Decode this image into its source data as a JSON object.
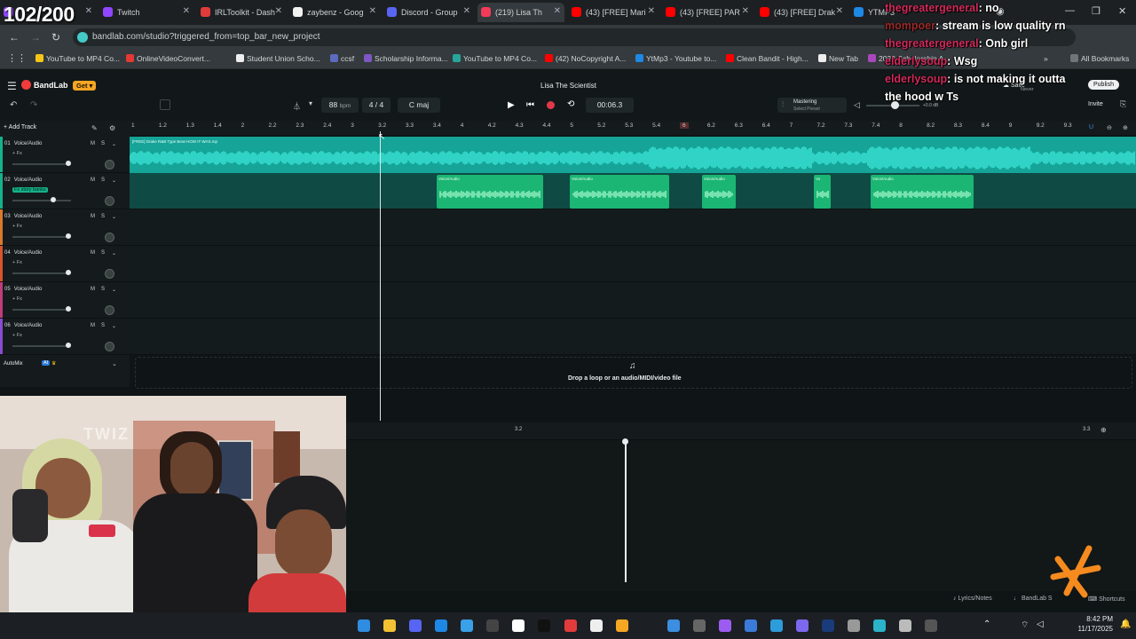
{
  "overlay": {
    "counter": "102/200",
    "chat": [
      {
        "user": "thegreatergeneral",
        "sep": ":",
        "msg": " no"
      },
      {
        "user": "mompoer",
        "sep": ":",
        "msg": " stream is low quality rn"
      },
      {
        "user": "thegreatergeneral",
        "sep": ":",
        "msg": " Onb girl"
      },
      {
        "user": "elderlysoup",
        "sep": ":",
        "msg": " Wsg"
      },
      {
        "user": "elderlysoup",
        "sep": ":",
        "msg": " is not making it outta"
      },
      {
        "user": "",
        "sep": "",
        "msg": "the hood w Ts"
      }
    ],
    "webcam_text": "TWIZ"
  },
  "browser": {
    "tabs": [
      {
        "label": "",
        "icon_color": "#9146ff"
      },
      {
        "label": "Twitch",
        "icon_color": "#9146ff"
      },
      {
        "label": "IRLToolkit - Dash",
        "icon_color": "#e23b3b"
      },
      {
        "label": "zaybenz - Goog",
        "icon_color": "#f2f2f2"
      },
      {
        "label": "Discord - Group",
        "icon_color": "#5865f2"
      },
      {
        "label": "(219) Lisa Th",
        "icon_color": "#f23b5a",
        "active": true
      },
      {
        "label": "(43) [FREE] Mari",
        "icon_color": "#ff0000"
      },
      {
        "label": "(43) [FREE] PAR",
        "icon_color": "#ff0000"
      },
      {
        "label": "(43) [FREE] Drak",
        "icon_color": "#ff0000"
      },
      {
        "label": "YTMP3",
        "icon_color": "#1e88e5"
      }
    ],
    "url": "bandlab.com/studio?triggered_from=top_bar_new_project",
    "bookmarks": [
      {
        "label": "YouTube to MP4 Co...",
        "icon_color": "#f5c518"
      },
      {
        "label": "OnlineVideoConvert...",
        "icon_color": "#e53935"
      },
      {
        "label": "Student Union Scho...",
        "icon_color": "#eeeeee"
      },
      {
        "label": "ccsf",
        "icon_color": "#5c6bc0"
      },
      {
        "label": "Scholarship Informa...",
        "icon_color": "#7e57c2"
      },
      {
        "label": "YouTube to MP4 Co...",
        "icon_color": "#26a69a"
      },
      {
        "label": "(42) NoCopyright A...",
        "icon_color": "#ff0000"
      },
      {
        "label": "YtMp3 - Youtube to...",
        "icon_color": "#1e88e5"
      },
      {
        "label": "Clean Bandit - High...",
        "icon_color": "#ff0000"
      },
      {
        "label": "New Tab",
        "icon_color": "#eeeeee"
      },
      {
        "label": "2023 Scholarship A...",
        "icon_color": "#ab47bc"
      }
    ],
    "all_bookmarks": "All Bookmarks"
  },
  "bandlab": {
    "logo": "BandLab",
    "get_badge": "Get",
    "project_title": "Lisa The Scientist",
    "tempo": "88",
    "tempo_unit": "bpm",
    "time_sig": "4 / 4",
    "key": "C maj",
    "time": "00:06.3",
    "mastering_label": "Mastering",
    "mastering_sub": "Select Preset",
    "volume_readout": "+0.0 dB",
    "save": "Save",
    "never": "Never",
    "publish": "Publish",
    "invite": "Invite",
    "add_track": "Add Track",
    "automix": "AutoMix",
    "drop_text": "Drop a loop or an audio/MIDI/video file",
    "lyrics": "Lyrics/Notes",
    "bandlab_sounds": "BandLab S",
    "shortcuts": "Shortcuts",
    "editor_ruler": [
      "3.2",
      "3.3"
    ],
    "tracks": [
      {
        "num": "01",
        "name": "Voice/Audio",
        "fx": "+ Fx",
        "color": "#14b38a",
        "vol": 0.95
      },
      {
        "num": "02",
        "name": "Voice/Audio",
        "fx": "Fx story banks",
        "color": "#14b38a",
        "vol": 0.7
      },
      {
        "num": "03",
        "name": "Voice/Audio",
        "fx": "+ Fx",
        "color": "#d97a2b",
        "vol": 0.95
      },
      {
        "num": "04",
        "name": "Voice/Audio",
        "fx": "+ Fx",
        "color": "#d9542b",
        "vol": 0.95
      },
      {
        "num": "05",
        "name": "Voice/Audio",
        "fx": "+ Fx",
        "color": "#c23b7a",
        "vol": 0.95
      },
      {
        "num": "06",
        "name": "Voice/Audio",
        "fx": "+ Fx",
        "color": "#8a4bd0",
        "vol": 0.95
      }
    ],
    "ruler": [
      "1",
      "1.2",
      "1.3",
      "1.4",
      "2",
      "2.2",
      "2.3",
      "2.4",
      "3",
      "3.2",
      "3.3",
      "3.4",
      "4",
      "4.2",
      "4.3",
      "4.4",
      "5",
      "5.2",
      "5.3",
      "5.4",
      "6",
      "6.2",
      "6.3",
      "6.4",
      "7",
      "7.2",
      "7.3",
      "7.4",
      "8",
      "8.2",
      "8.3",
      "8.4",
      "9",
      "9.2",
      "9.3"
    ],
    "region_main": "[FREE] Drake R&B Type Beat HOW IT WAS.mp",
    "regions": [
      "Voice/Audio",
      "Voice/Audio",
      "Voice/Audio",
      "Vo",
      "Voice/Audio"
    ]
  },
  "taskbar": {
    "time": "8:42 PM",
    "date": "11/17/2025"
  }
}
